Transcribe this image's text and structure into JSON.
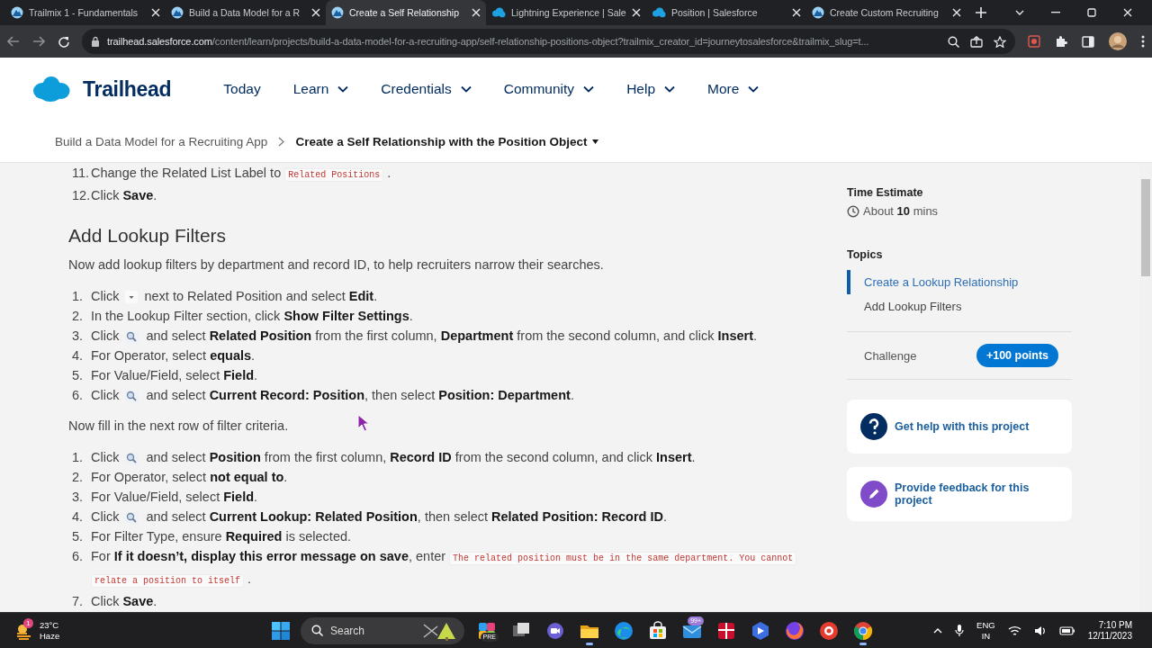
{
  "browser": {
    "tabs": [
      {
        "title": "Trailmix 1 - Fundamentals",
        "kind": "trailhead",
        "selected": false
      },
      {
        "title": "Build a Data Model for a R",
        "kind": "trailhead",
        "selected": false
      },
      {
        "title": "Create a Self Relationship",
        "kind": "trailhead",
        "selected": true
      },
      {
        "title": "Lightning Experience | Sale",
        "kind": "cloud",
        "selected": false
      },
      {
        "title": "Position | Salesforce",
        "kind": "cloud",
        "selected": false
      },
      {
        "title": "Create Custom Recruiting",
        "kind": "trailhead",
        "selected": false
      }
    ],
    "url": {
      "domain": "trailhead.salesforce.com",
      "path": "/content/learn/projects/build-a-data-model-for-a-recruiting-app/self-relationship-positions-object?trailmix_creator_id=journeytosalesforce&trailmix_slug=t..."
    }
  },
  "site": {
    "logo": "Trailhead",
    "nav": [
      {
        "label": "Today",
        "menu": false
      },
      {
        "label": "Learn",
        "menu": true
      },
      {
        "label": "Credentials",
        "menu": true
      },
      {
        "label": "Community",
        "menu": true
      },
      {
        "label": "Help",
        "menu": true
      },
      {
        "label": "More",
        "menu": true
      }
    ],
    "breadcrumb": [
      {
        "label": "Build a Data Model for a Recruiting App",
        "current": false
      },
      {
        "label": "Create a Self Relationship with the Position Object",
        "current": true
      }
    ]
  },
  "lesson": {
    "blocks": [
      {
        "kind": "list",
        "items": [
          {
            "number": "11.",
            "parts": [
              {
                "kind": "text",
                "text": "Change the Related List Label to"
              },
              {
                "kind": "code",
                "text": "Related Positions"
              },
              {
                "kind": "text",
                "text": "."
              }
            ]
          },
          {
            "number": "12.",
            "parts": [
              {
                "kind": "text",
                "text": "Click **Save**."
              }
            ]
          }
        ]
      },
      {
        "kind": "heading",
        "text": "Add Lookup Filters"
      },
      {
        "kind": "paragraph",
        "text": "Now add lookup filters by department and record ID, to help recruiters narrow their searches."
      },
      {
        "kind": "list",
        "items": [
          {
            "number": "1.",
            "parts": [
              {
                "kind": "text",
                "text": "Click"
              },
              {
                "kind": "caret"
              },
              {
                "kind": "text",
                "text": "next to Related Position and select **Edit**."
              }
            ]
          },
          {
            "number": "2.",
            "parts": [
              {
                "kind": "text",
                "text": "In the Lookup Filter section, click **Show Filter Settings**."
              }
            ]
          },
          {
            "number": "3.",
            "parts": [
              {
                "kind": "text",
                "text": "Click"
              },
              {
                "kind": "lookup"
              },
              {
                "kind": "text",
                "text": "and select **Related Position** from the first column, **Department** from the second column, and click **Insert**."
              }
            ]
          },
          {
            "number": "4.",
            "parts": [
              {
                "kind": "text",
                "text": "For Operator, select **equals**."
              }
            ]
          },
          {
            "number": "5.",
            "parts": [
              {
                "kind": "text",
                "text": "For Value/Field, select **Field**."
              }
            ]
          },
          {
            "number": "6.",
            "parts": [
              {
                "kind": "text",
                "text": "Click"
              },
              {
                "kind": "lookup"
              },
              {
                "kind": "text",
                "text": "and select **Current Record: Position**, then select **Position: Department**."
              }
            ]
          }
        ]
      },
      {
        "kind": "paragraph",
        "text": "Now fill in the next row of filter criteria."
      },
      {
        "kind": "list",
        "items": [
          {
            "number": "1.",
            "parts": [
              {
                "kind": "text",
                "text": "Click"
              },
              {
                "kind": "lookup"
              },
              {
                "kind": "text",
                "text": "and select **Position** from the first column, **Record ID** from the second column, and click **Insert**."
              }
            ]
          },
          {
            "number": "2.",
            "parts": [
              {
                "kind": "text",
                "text": "For Operator, select **not equal to**."
              }
            ]
          },
          {
            "number": "3.",
            "parts": [
              {
                "kind": "text",
                "text": "For Value/Field, select **Field**."
              }
            ]
          },
          {
            "number": "4.",
            "parts": [
              {
                "kind": "text",
                "text": "Click"
              },
              {
                "kind": "lookup"
              },
              {
                "kind": "text",
                "text": "and select **Current Lookup: Related Position**, then select **Related Position: Record ID**."
              }
            ]
          },
          {
            "number": "5.",
            "parts": [
              {
                "kind": "text",
                "text": "For Filter Type, ensure **Required** is selected."
              }
            ]
          },
          {
            "number": "6.",
            "parts": [
              {
                "kind": "text",
                "text": "For **If it doesn’t, display this error message on save**, enter"
              },
              {
                "kind": "code",
                "text": "The related position must be in the same department. You cannot"
              },
              {
                "kind": "code",
                "text": "relate a position to itself"
              },
              {
                "kind": "text",
                "text": "."
              }
            ]
          },
          {
            "number": "7.",
            "parts": [
              {
                "kind": "text",
                "text": "Click **Save**."
              }
            ]
          }
        ]
      }
    ]
  },
  "sidebar": {
    "time_label": "Time Estimate",
    "time": "About **10** mins",
    "topics_label": "Topics",
    "topics": [
      {
        "label": "Create a Lookup Relationship",
        "selected": true
      },
      {
        "label": "Add Lookup Filters",
        "selected": false
      }
    ],
    "challenge": {
      "label": "Challenge",
      "points": "+100 points"
    },
    "cards": [
      {
        "kind": "help",
        "label": "Get help with this project"
      },
      {
        "kind": "feedback",
        "label": "Provide feedback for this project"
      }
    ]
  },
  "taskbar": {
    "weather": {
      "badge": "1",
      "temperature": "23°C",
      "condition": "Haze"
    },
    "search": {
      "label": "Search"
    },
    "apps": [
      {
        "kind": "copilot",
        "active": false,
        "badge": "PRE"
      },
      {
        "kind": "taskview",
        "active": false
      },
      {
        "kind": "chat",
        "active": false
      },
      {
        "kind": "explorer",
        "active": true
      },
      {
        "kind": "edge",
        "active": false
      },
      {
        "kind": "store",
        "active": false
      },
      {
        "kind": "mail",
        "active": false,
        "badge": "99+"
      },
      {
        "kind": "gift",
        "active": false
      },
      {
        "kind": "play",
        "active": false
      },
      {
        "kind": "firefox",
        "active": false
      },
      {
        "kind": "ring",
        "active": false
      },
      {
        "kind": "chrome",
        "active": true
      }
    ],
    "tray": {
      "language": "ENG",
      "region": "IN",
      "time": "7:10 PM",
      "date": "12/11/2023"
    }
  }
}
